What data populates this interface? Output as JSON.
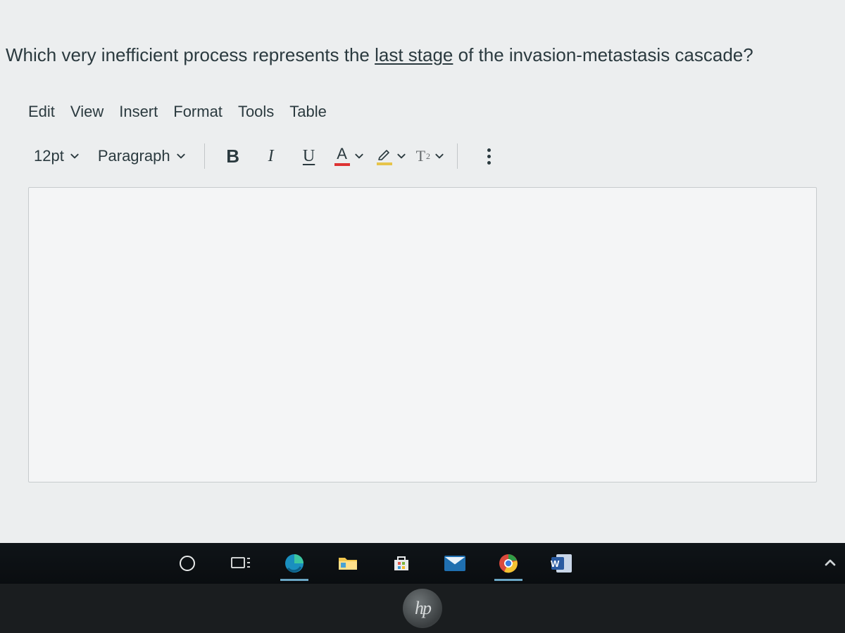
{
  "question": {
    "pre": "Which very inefficient process represents the ",
    "underlined": "last stage",
    "post": " of the invasion-metastasis cascade?"
  },
  "editor": {
    "menus": [
      "Edit",
      "View",
      "Insert",
      "Format",
      "Tools",
      "Table"
    ],
    "font_size": "12pt",
    "block_format": "Paragraph",
    "bold": "B",
    "italic": "I",
    "underline": "U",
    "text_color_letter": "A",
    "superscript_base": "T",
    "superscript_exp": "2"
  },
  "taskbar": {
    "word_badge": "W"
  },
  "logo": {
    "text": "hp"
  }
}
